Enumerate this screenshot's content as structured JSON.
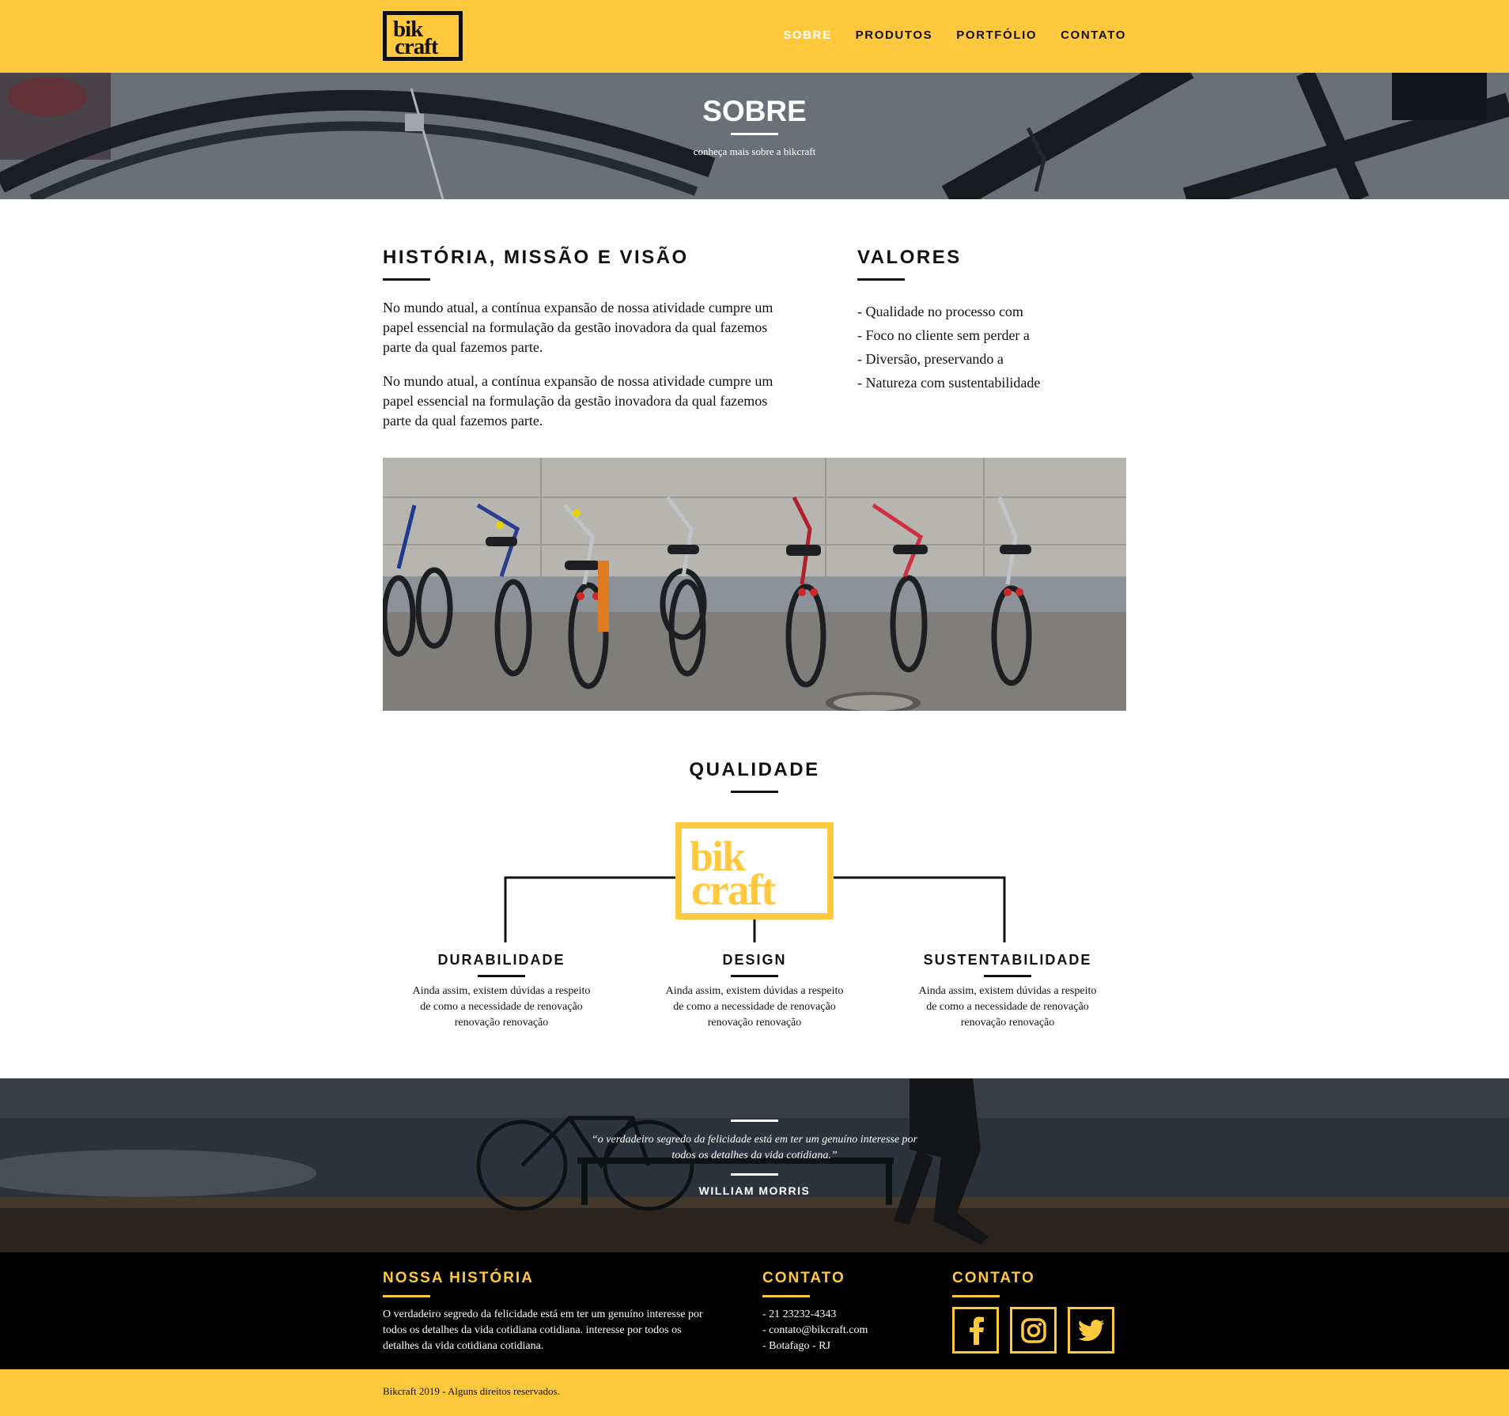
{
  "brand": {
    "logo_line1": "bik",
    "logo_line2": "craft"
  },
  "nav": {
    "items": [
      "SOBRE",
      "PRODUTOS",
      "PORTFÓLIO",
      "CONTATO"
    ],
    "active": "SOBRE"
  },
  "hero": {
    "title": "SOBRE",
    "subtitle": "conheça mais sobre a bikcraft"
  },
  "about": {
    "heading": "HISTÓRIA, MISSÃO E VISÃO",
    "paragraphs": [
      "No mundo atual, a contínua expansão de nossa atividade cumpre um papel essencial na formulação da gestão inovadora da qual fazemos parte da qual fazemos parte.",
      "No mundo atual, a contínua expansão de nossa atividade cumpre um papel essencial na formulação da gestão inovadora da qual fazemos parte da qual fazemos parte."
    ]
  },
  "values": {
    "heading": "VALORES",
    "items": [
      "- Qualidade no processo com",
      "- Foco no cliente sem perder a",
      "- Diversão, preservando a",
      "- Natureza com sustentabilidade"
    ]
  },
  "quality": {
    "heading": "QUALIDADE",
    "features": [
      {
        "title": "DURABILIDADE",
        "desc": "Ainda assim, existem dúvidas a respeito de como a necessidade de renovação renovação renovação"
      },
      {
        "title": "DESIGN",
        "desc": "Ainda assim, existem dúvidas a respeito de como a necessidade de renovação renovação renovação"
      },
      {
        "title": "SUSTENTABILIDADE",
        "desc": "Ainda assim, existem dúvidas a respeito de como a necessidade de renovação renovação renovação"
      }
    ]
  },
  "quote": {
    "text": "“o verdadeiro segredo da felicidade está em ter um genuíno interesse por todos os detalhes da vida cotidiana.”",
    "author": "WILLIAM MORRIS"
  },
  "footer": {
    "history": {
      "heading": "NOSSA HISTÓRIA",
      "text": "O verdadeiro segredo da felicidade está em ter um genuíno interesse por todos os detalhes da vida cotidiana cotidiana. interesse por todos os detalhes da vida cotidiana cotidiana."
    },
    "contact": {
      "heading": "CONTATO",
      "phone": "- 21 23232-4343",
      "email": "- contato@bikcraft.com",
      "address": "- Botafago - RJ"
    },
    "social": {
      "heading": "CONTATO",
      "icons": [
        "facebook-icon",
        "instagram-icon",
        "twitter-icon"
      ]
    }
  },
  "copyright": "Bikcraft 2019 - Alguns direitos reservados.",
  "colors": {
    "accent": "#ffc83d",
    "dark": "#111111",
    "footer_bg": "#000000"
  }
}
